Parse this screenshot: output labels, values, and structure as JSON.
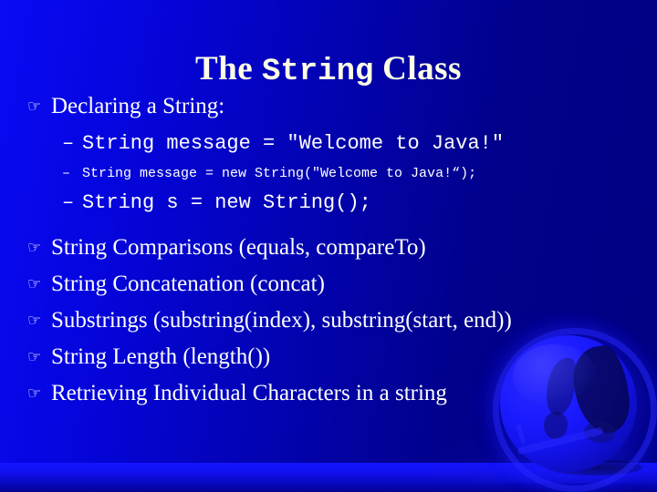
{
  "slide": {
    "title": {
      "before": "The ",
      "mono": "String",
      "after": " Class"
    },
    "bullet_glyph": "☞",
    "dash_glyph": "–",
    "colors": {
      "background_left": "#0A0AF4",
      "background_right": "#000080",
      "title_text": "#FFFFE6",
      "body_text": "#FFFFFF",
      "floor_band": "#1414FF"
    },
    "items": [
      {
        "level": 1,
        "text": "Declaring a String:"
      },
      {
        "level": 2,
        "size": "big",
        "text": "String message = \"Welcome to Java!\""
      },
      {
        "level": 2,
        "size": "small",
        "text": "String message = new String(\"Welcome to Java!“);"
      },
      {
        "level": 2,
        "size": "big",
        "text": "String s = new String();"
      },
      {
        "level": 1,
        "text": "String Comparisons (equals, compareTo)"
      },
      {
        "level": 1,
        "text": "String Concatenation (concat)"
      },
      {
        "level": 1,
        "text": "Substrings (substring(index), substring(start, end))"
      },
      {
        "level": 1,
        "text": "String Length (length())"
      },
      {
        "level": 1,
        "text": "Retrieving Individual Characters in a string"
      }
    ]
  }
}
